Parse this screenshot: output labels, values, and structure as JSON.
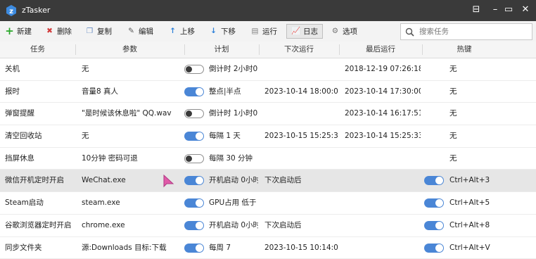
{
  "window": {
    "title": "zTasker"
  },
  "toolbar": {
    "new": "新建",
    "delete": "删除",
    "copy": "复制",
    "edit": "编辑",
    "up": "上移",
    "down": "下移",
    "run": "运行",
    "log": "日志",
    "options": "选项",
    "search_placeholder": "搜索任务"
  },
  "columns": [
    "任务",
    "参数",
    "计划",
    "下次运行",
    "最后运行",
    "热键"
  ],
  "rows": [
    {
      "task": "关机",
      "param": "无",
      "enabled": false,
      "plan": "倒计时 2小时0",
      "next": "",
      "last": "2018-12-19 07:26:18",
      "hk_enabled": null,
      "hotkey": "无"
    },
    {
      "task": "报时",
      "param": "音量8 真人",
      "enabled": true,
      "plan": "整点|半点",
      "next": "2023-10-14 18:00:00",
      "last": "2023-10-14 17:30:00",
      "hk_enabled": null,
      "hotkey": "无"
    },
    {
      "task": "弹窗提醒",
      "param": "\"是时候该休息啦\" QQ.wav",
      "enabled": false,
      "plan": "倒计时 1小时0",
      "next": "",
      "last": "2023-10-14 16:17:51",
      "hk_enabled": null,
      "hotkey": "无"
    },
    {
      "task": "清空回收站",
      "param": "无",
      "enabled": true,
      "plan": "每隔 1 天",
      "next": "2023-10-15 15:25:33",
      "last": "2023-10-14 15:25:33",
      "hk_enabled": null,
      "hotkey": "无"
    },
    {
      "task": "挡屏休息",
      "param": "10分钟 密码可退",
      "enabled": false,
      "plan": "每隔 30 分钟",
      "next": "",
      "last": "",
      "hk_enabled": null,
      "hotkey": "无"
    },
    {
      "task": "微信开机定时开启",
      "param": "WeChat.exe",
      "enabled": true,
      "plan": "开机启动 0小时",
      "next": "下次启动后",
      "last": "",
      "hk_enabled": true,
      "hotkey": "Ctrl+Alt+3"
    },
    {
      "task": "Steam启动",
      "param": "steam.exe",
      "enabled": true,
      "plan": "GPU占用 低于",
      "next": "",
      "last": "",
      "hk_enabled": true,
      "hotkey": "Ctrl+Alt+5"
    },
    {
      "task": "谷歌浏览器定时开启",
      "param": "chrome.exe",
      "enabled": true,
      "plan": "开机启动 0小时",
      "next": "下次启动后",
      "last": "",
      "hk_enabled": true,
      "hotkey": "Ctrl+Alt+8"
    },
    {
      "task": "同步文件夹",
      "param": "源:Downloads 目标:下载",
      "enabled": true,
      "plan": "每周 7",
      "next": "2023-10-15 10:14:00",
      "last": "",
      "hk_enabled": true,
      "hotkey": "Ctrl+Alt+V"
    }
  ],
  "colors": {
    "titlebar": "#3a3a3a",
    "toggle_on": "#4a86d6",
    "selected_row": "#e6e6e6",
    "cursor": "#e05aa8"
  }
}
